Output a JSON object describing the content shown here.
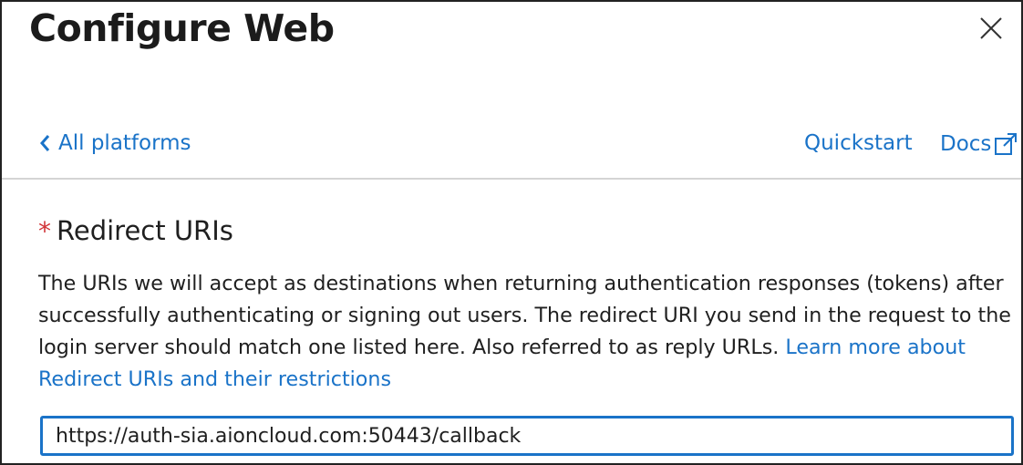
{
  "panel": {
    "title": "Configure Web"
  },
  "nav": {
    "back_label": "All platforms",
    "quickstart_label": "Quickstart",
    "docs_label": "Docs"
  },
  "redirect": {
    "required_marker": "*",
    "heading": "Redirect URIs",
    "description": "The URIs we will accept as destinations when returning authentication responses (tokens) after successfully authenticating or signing out users. The redirect URI you send in the request to the login server should match one listed here. Also referred to as reply URLs. ",
    "learn_more": "Learn more about Redirect URIs and their restrictions",
    "uri_value": "https://auth-sia.aioncloud.com:50443/callback"
  },
  "icons": {
    "close": "close-icon",
    "back": "chevron-left-icon",
    "external": "external-link-icon"
  },
  "colors": {
    "link": "#1a73c8",
    "required": "#d13438"
  }
}
